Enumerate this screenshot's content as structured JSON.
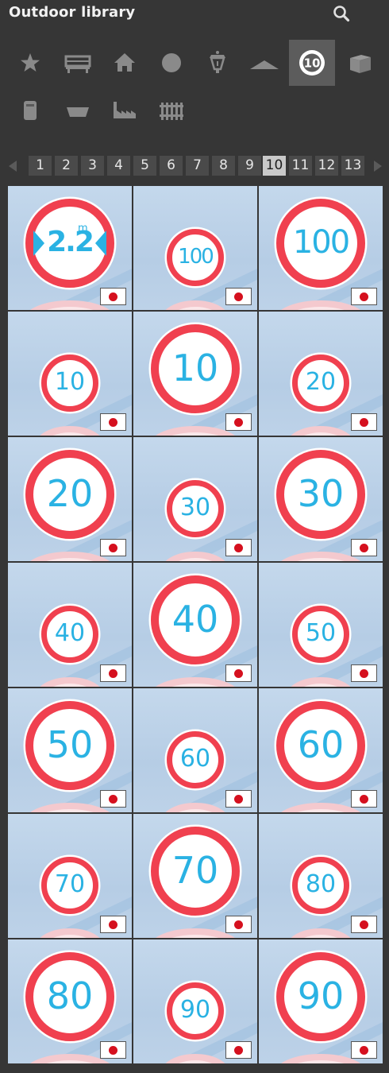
{
  "header": {
    "title": "Outdoor library",
    "search_icon": "search-icon"
  },
  "categories": [
    {
      "name": "star-icon",
      "active": false
    },
    {
      "name": "bench-icon",
      "active": false
    },
    {
      "name": "house-icon",
      "active": false
    },
    {
      "name": "ball-icon",
      "active": false
    },
    {
      "name": "lantern-icon",
      "active": false
    },
    {
      "name": "roof-icon",
      "active": false
    },
    {
      "name": "speed-sign-icon",
      "active": true,
      "label": "10"
    },
    {
      "name": "box-icon",
      "active": false
    },
    {
      "name": "bin-icon",
      "active": false
    },
    {
      "name": "planter-icon",
      "active": false
    },
    {
      "name": "factory-icon",
      "active": false
    },
    {
      "name": "fence-icon",
      "active": false
    }
  ],
  "pagination": {
    "pages": [
      "1",
      "2",
      "3",
      "4",
      "5",
      "6",
      "7",
      "8",
      "9",
      "10",
      "11",
      "12",
      "13"
    ],
    "current": "10",
    "prev_icon": "left-arrow-icon",
    "next_icon": "right-arrow-icon"
  },
  "colors": {
    "sign_red": "#f0404f",
    "sign_blue": "#2ab2e3",
    "flag_red": "#d5101e",
    "active_bg": "#5c5c5c"
  },
  "items": [
    {
      "label": "2.2",
      "unit": "m",
      "size": "large",
      "type": "height-limit"
    },
    {
      "label": "100",
      "size": "small"
    },
    {
      "label": "100",
      "size": "large"
    },
    {
      "label": "10",
      "size": "small"
    },
    {
      "label": "10",
      "size": "large"
    },
    {
      "label": "20",
      "size": "small"
    },
    {
      "label": "20",
      "size": "large"
    },
    {
      "label": "30",
      "size": "small"
    },
    {
      "label": "30",
      "size": "large"
    },
    {
      "label": "40",
      "size": "small"
    },
    {
      "label": "40",
      "size": "large"
    },
    {
      "label": "50",
      "size": "small"
    },
    {
      "label": "50",
      "size": "large"
    },
    {
      "label": "60",
      "size": "small"
    },
    {
      "label": "60",
      "size": "large"
    },
    {
      "label": "70",
      "size": "small"
    },
    {
      "label": "70",
      "size": "large"
    },
    {
      "label": "80",
      "size": "small"
    },
    {
      "label": "80",
      "size": "large"
    },
    {
      "label": "90",
      "size": "small"
    },
    {
      "label": "90",
      "size": "large"
    }
  ]
}
